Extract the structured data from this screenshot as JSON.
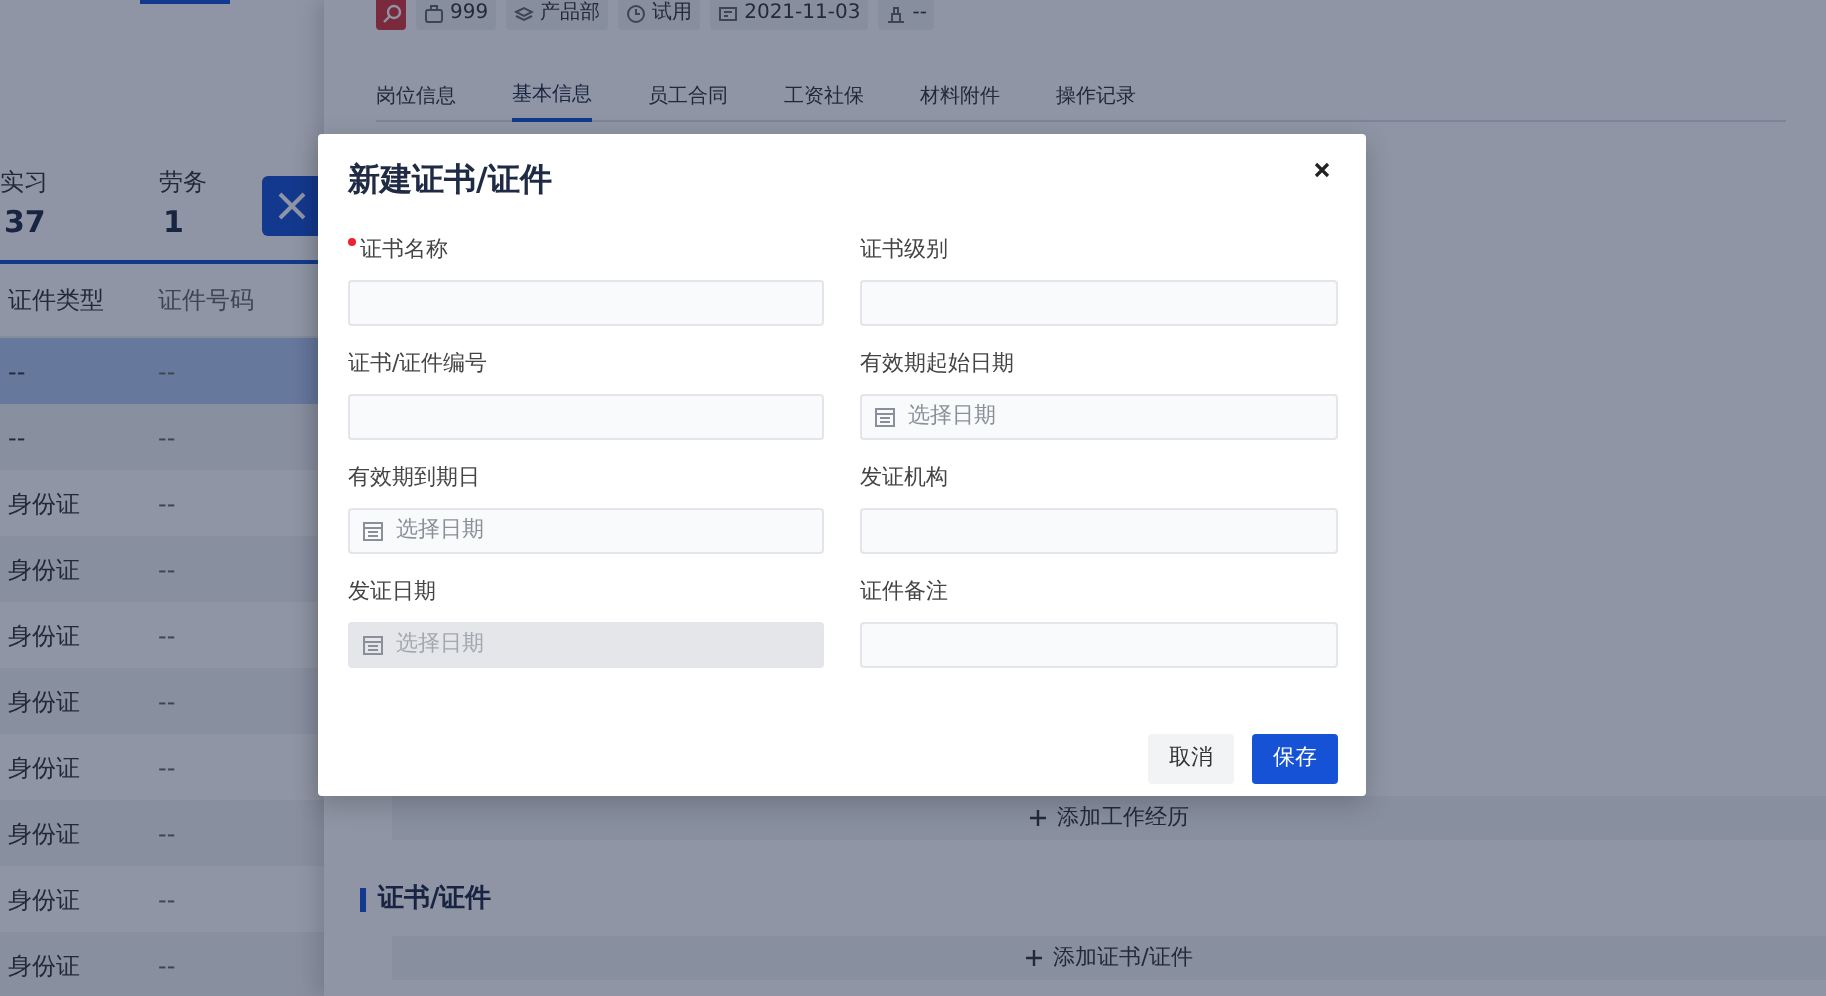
{
  "left_panel": {
    "stats": [
      {
        "label": "实习",
        "value": "37"
      },
      {
        "label": "劳务",
        "value": "1"
      }
    ],
    "table": {
      "columns": [
        "证件类型",
        "证件号码"
      ],
      "rows": [
        {
          "cells": [
            "--",
            "--"
          ],
          "selected": true
        },
        {
          "cells": [
            "--",
            "--"
          ],
          "selected": false
        },
        {
          "cells": [
            "身份证",
            "--"
          ],
          "selected": false
        },
        {
          "cells": [
            "身份证",
            "--"
          ],
          "selected": false
        },
        {
          "cells": [
            "身份证",
            "--"
          ],
          "selected": false
        },
        {
          "cells": [
            "身份证",
            "--"
          ],
          "selected": false
        },
        {
          "cells": [
            "身份证",
            "--"
          ],
          "selected": false
        },
        {
          "cells": [
            "身份证",
            "--"
          ],
          "selected": false
        },
        {
          "cells": [
            "身份证",
            "--"
          ],
          "selected": false
        },
        {
          "cells": [
            "身份证",
            "--"
          ],
          "selected": false
        }
      ]
    }
  },
  "drawer": {
    "tags": [
      "999",
      "产品部",
      "试用",
      "2021-11-03",
      "--"
    ],
    "tabs": [
      {
        "label": "岗位信息",
        "selected": false
      },
      {
        "label": "基本信息",
        "selected": true
      },
      {
        "label": "员工合同",
        "selected": false
      },
      {
        "label": "工资社保",
        "selected": false
      },
      {
        "label": "材料附件",
        "selected": false
      },
      {
        "label": "操作记录",
        "selected": false
      }
    ],
    "add_work_button": "添加工作经历",
    "section_title": "证书/证件",
    "add_certificate_button": "添加证书/证件"
  },
  "dialog": {
    "title": "新建证书/证件",
    "fields": [
      {
        "label": "证书名称",
        "kind": "text",
        "required": true,
        "disabled": false
      },
      {
        "label": "证书级别",
        "kind": "text",
        "required": false,
        "disabled": false
      },
      {
        "label": "证书/证件编号",
        "kind": "text",
        "required": false,
        "disabled": false
      },
      {
        "label": "有效期起始日期",
        "kind": "date",
        "placeholder": "选择日期",
        "required": false,
        "disabled": false
      },
      {
        "label": "有效期到期日",
        "kind": "date",
        "placeholder": "选择日期",
        "required": false,
        "disabled": false
      },
      {
        "label": "发证机构",
        "kind": "text",
        "required": false,
        "disabled": false
      },
      {
        "label": "发证日期",
        "kind": "date",
        "placeholder": "选择日期",
        "required": false,
        "disabled": true
      },
      {
        "label": "证件备注",
        "kind": "text",
        "required": false,
        "disabled": false
      }
    ],
    "buttons": [
      {
        "label": "取消",
        "kind": "secondary"
      },
      {
        "label": "保存",
        "kind": "primary"
      }
    ]
  }
}
